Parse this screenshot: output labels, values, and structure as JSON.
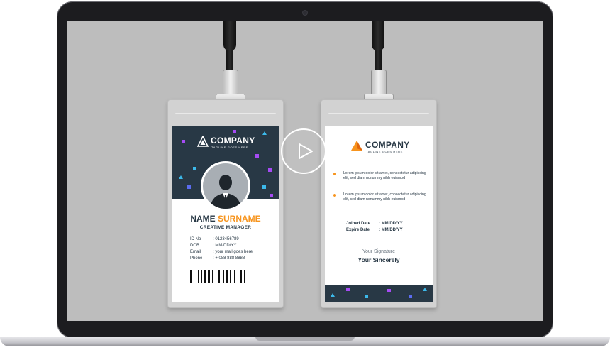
{
  "front": {
    "company": "COMPANY",
    "tagline": "TAGLINE GOES HERE",
    "first_name": "NAME",
    "last_name": "SURNAME",
    "role": "CREATIVE MANAGER",
    "fields": [
      {
        "label": "ID No",
        "value": ": 0123456789"
      },
      {
        "label": "DOB",
        "value": ": MM/DD/YY"
      },
      {
        "label": "Email",
        "value": ": your mail goes here"
      },
      {
        "label": "Phone",
        "value": ": + 088 888 8888"
      }
    ]
  },
  "back": {
    "company": "COMPANY",
    "tagline": "TAGLINE GOES HERE",
    "bullets": [
      "Lorem ipsum dolor sit amet, consectetur adipiscing elit, sed diam nonummy nibh euismod",
      "Lorem ipsum dolor sit amet, consectetur adipiscing elit, sed diam nonummy nibh euismod"
    ],
    "joined_label": "Joined Date",
    "joined_value": ": MM/DD/YY",
    "expire_label": "Expire Date",
    "expire_value": ": MM/DD/YY",
    "signature_label": "Your Signature",
    "signature_name": "Your Sincerely"
  },
  "colors": {
    "navy": "#283845",
    "accent_orange": "#f7941d",
    "confetti": [
      "#a64bf4",
      "#3cb9ea",
      "#5b6cf0"
    ]
  },
  "icons": [
    "play-icon",
    "logo-icon",
    "person-silhouette-icon",
    "barcode-icon"
  ]
}
